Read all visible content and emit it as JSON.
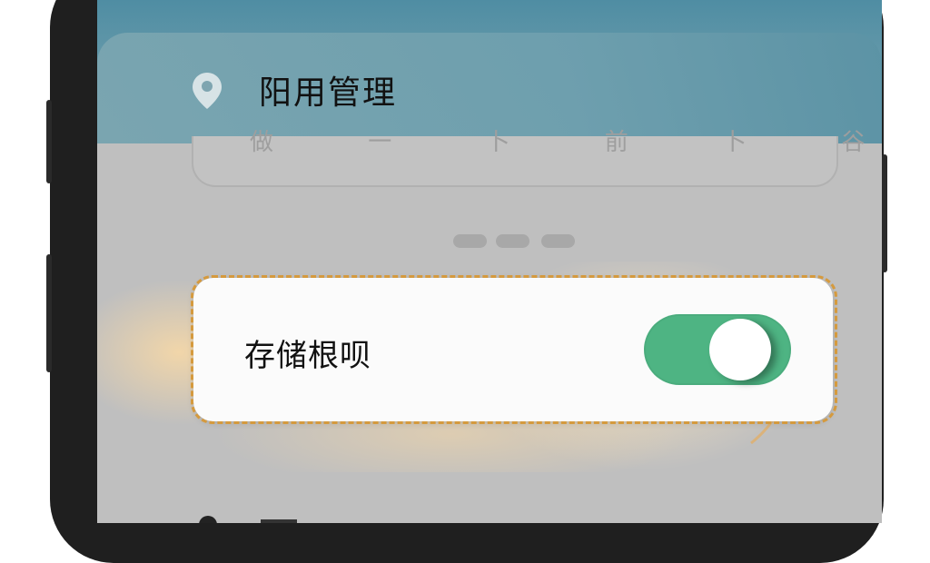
{
  "header": {
    "location_icon": "map-pin-icon",
    "location_label": "阳用管理"
  },
  "underlay": {
    "partial_text": "做 一 卜 前 卜 谷 分"
  },
  "pager": {
    "dot_count": 3
  },
  "setting_row": {
    "label": "存储根呗",
    "toggle_state": "on",
    "toggle_color": "#4eb483"
  },
  "colors": {
    "screen_bg": "#bfbfbf",
    "header_bg": "#6e9fae",
    "highlight": "#d59a3e"
  }
}
